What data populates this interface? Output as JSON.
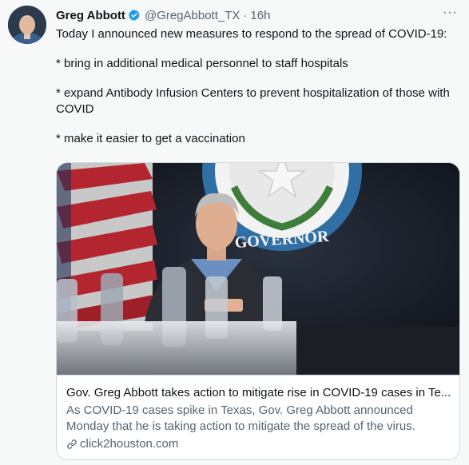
{
  "tweet": {
    "author_name": "Greg Abbott",
    "handle": "@GregAbbott_TX",
    "separator": "·",
    "time": "16h",
    "more_label": "···",
    "paragraphs": [
      "Today I announced new measures to respond to the spread of COVID-19:",
      "* bring in additional medical personnel to staff hospitals",
      "* expand Antibody Infusion Centers to prevent hospitalization of those with COVID",
      "* make it easier to get a vaccination"
    ]
  },
  "card": {
    "seal_text": "GOVERNOR",
    "title": "Gov. Greg Abbott takes action to mitigate rise in COVID-19 cases in Te...",
    "description": "As COVID-19 cases spike in Texas, Gov. Greg Abbott announced Monday that he is taking action to mitigate the spread of the virus.",
    "domain": "click2houston.com"
  },
  "colors": {
    "verified_blue": "#1d9bf0",
    "text_primary": "#0f1419",
    "text_secondary": "#536471",
    "border": "#cfd9de"
  },
  "icons": {
    "verified": "verified-badge-icon",
    "more": "more-horizontal-icon",
    "link": "link-icon"
  }
}
